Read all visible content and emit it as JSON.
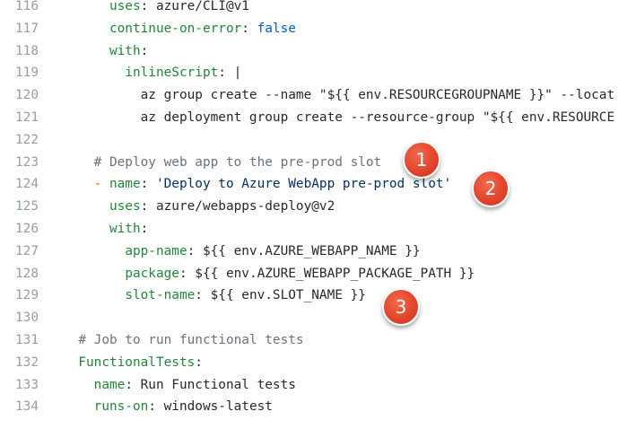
{
  "editor": {
    "lines": [
      {
        "number": "116",
        "indent": "      ",
        "parts": [
          {
            "t": "key",
            "v": "uses"
          },
          {
            "t": "plain",
            "v": ": azure/CLI@v1"
          }
        ]
      },
      {
        "number": "117",
        "indent": "      ",
        "parts": [
          {
            "t": "key",
            "v": "continue-on-error"
          },
          {
            "t": "plain",
            "v": ": "
          },
          {
            "t": "bool",
            "v": "false"
          }
        ]
      },
      {
        "number": "118",
        "indent": "      ",
        "parts": [
          {
            "t": "key",
            "v": "with"
          },
          {
            "t": "plain",
            "v": ":"
          }
        ]
      },
      {
        "number": "119",
        "indent": "        ",
        "parts": [
          {
            "t": "key",
            "v": "inlineScript"
          },
          {
            "t": "plain",
            "v": ": |"
          }
        ]
      },
      {
        "number": "120",
        "indent": "          ",
        "parts": [
          {
            "t": "plain",
            "v": "az group create --name \"${{ env.RESOURCEGROUPNAME }}\" --locat"
          }
        ]
      },
      {
        "number": "121",
        "indent": "          ",
        "parts": [
          {
            "t": "plain",
            "v": "az deployment group create --resource-group \"${{ env.RESOURCE"
          }
        ]
      },
      {
        "number": "122",
        "indent": "",
        "parts": []
      },
      {
        "number": "123",
        "indent": "    ",
        "parts": [
          {
            "t": "com",
            "v": "# Deploy web app to the pre-prod slot"
          }
        ]
      },
      {
        "number": "124",
        "indent": "    ",
        "parts": [
          {
            "t": "dash",
            "v": "- "
          },
          {
            "t": "key",
            "v": "name"
          },
          {
            "t": "plain",
            "v": ": "
          },
          {
            "t": "str",
            "v": "'Deploy to Azure WebApp pre-prod slot'"
          }
        ]
      },
      {
        "number": "125",
        "indent": "      ",
        "parts": [
          {
            "t": "key",
            "v": "uses"
          },
          {
            "t": "plain",
            "v": ": azure/webapps-deploy@v2"
          }
        ]
      },
      {
        "number": "126",
        "indent": "      ",
        "parts": [
          {
            "t": "key",
            "v": "with"
          },
          {
            "t": "plain",
            "v": ":"
          }
        ]
      },
      {
        "number": "127",
        "indent": "        ",
        "parts": [
          {
            "t": "key",
            "v": "app-name"
          },
          {
            "t": "plain",
            "v": ": ${{ env.AZURE_WEBAPP_NAME }}"
          }
        ]
      },
      {
        "number": "128",
        "indent": "        ",
        "parts": [
          {
            "t": "key",
            "v": "package"
          },
          {
            "t": "plain",
            "v": ": ${{ env.AZURE_WEBAPP_PACKAGE_PATH }}"
          }
        ]
      },
      {
        "number": "129",
        "indent": "        ",
        "parts": [
          {
            "t": "key",
            "v": "slot-name"
          },
          {
            "t": "plain",
            "v": ": ${{ env.SLOT_NAME }}"
          }
        ]
      },
      {
        "number": "130",
        "indent": "",
        "parts": []
      },
      {
        "number": "131",
        "indent": "  ",
        "parts": [
          {
            "t": "com",
            "v": "# Job to run functional tests"
          }
        ]
      },
      {
        "number": "132",
        "indent": "  ",
        "parts": [
          {
            "t": "key",
            "v": "FunctionalTests"
          },
          {
            "t": "plain",
            "v": ":"
          }
        ]
      },
      {
        "number": "133",
        "indent": "    ",
        "parts": [
          {
            "t": "key",
            "v": "name"
          },
          {
            "t": "plain",
            "v": ": Run Functional tests"
          }
        ]
      },
      {
        "number": "134",
        "indent": "    ",
        "parts": [
          {
            "t": "key",
            "v": "runs-on"
          },
          {
            "t": "plain",
            "v": ": windows-latest"
          }
        ]
      }
    ]
  },
  "callouts": [
    {
      "label": "1"
    },
    {
      "label": "2"
    },
    {
      "label": "3"
    }
  ],
  "colors": {
    "key": "#22863a",
    "string": "#032f62",
    "comment": "#6a737d",
    "boolean": "#005cc5",
    "line_number": "#959da5",
    "callout": "#e2452b"
  }
}
